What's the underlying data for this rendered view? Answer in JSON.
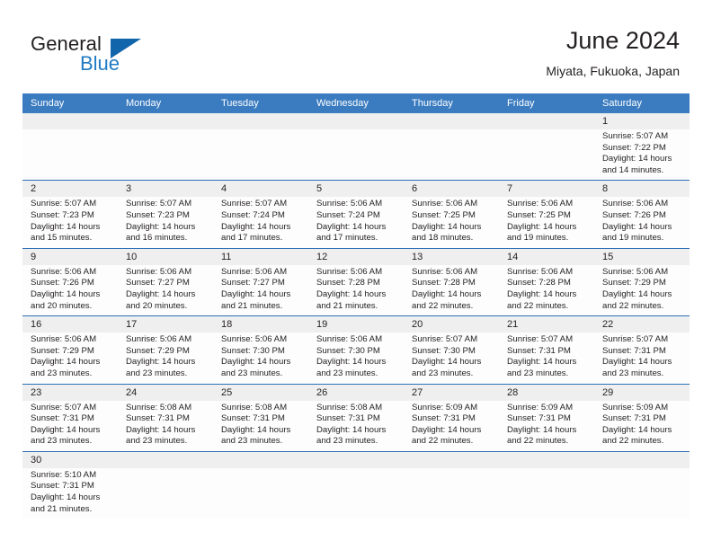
{
  "logo": {
    "word_top": "General",
    "word_bottom": "Blue",
    "triangle_icon": "triangle-icon",
    "color_blue": "#1f7ac4",
    "color_triangle": "#1166ab",
    "color_dark": "#221f1f"
  },
  "header": {
    "title": "June 2024",
    "subtitle": "Miyata, Fukuoka, Japan"
  },
  "theme": {
    "header_blue": "#3b7cc0",
    "row_divider": "#2f6fb5",
    "day_band_gray": "#efefef",
    "cell_bg": "#fdfdfd",
    "text": "#231f20"
  },
  "calendar": {
    "weekdays": [
      "Sunday",
      "Monday",
      "Tuesday",
      "Wednesday",
      "Thursday",
      "Friday",
      "Saturday"
    ],
    "weeks": [
      [
        {
          "day": "",
          "empty": true,
          "lines": []
        },
        {
          "day": "",
          "empty": true,
          "lines": []
        },
        {
          "day": "",
          "empty": true,
          "lines": []
        },
        {
          "day": "",
          "empty": true,
          "lines": []
        },
        {
          "day": "",
          "empty": true,
          "lines": []
        },
        {
          "day": "",
          "empty": true,
          "lines": []
        },
        {
          "day": "1",
          "empty": false,
          "lines": [
            "Sunrise: 5:07 AM",
            "Sunset: 7:22 PM",
            "Daylight: 14 hours",
            "and 14 minutes."
          ]
        }
      ],
      [
        {
          "day": "2",
          "empty": false,
          "lines": [
            "Sunrise: 5:07 AM",
            "Sunset: 7:23 PM",
            "Daylight: 14 hours",
            "and 15 minutes."
          ]
        },
        {
          "day": "3",
          "empty": false,
          "lines": [
            "Sunrise: 5:07 AM",
            "Sunset: 7:23 PM",
            "Daylight: 14 hours",
            "and 16 minutes."
          ]
        },
        {
          "day": "4",
          "empty": false,
          "lines": [
            "Sunrise: 5:07 AM",
            "Sunset: 7:24 PM",
            "Daylight: 14 hours",
            "and 17 minutes."
          ]
        },
        {
          "day": "5",
          "empty": false,
          "lines": [
            "Sunrise: 5:06 AM",
            "Sunset: 7:24 PM",
            "Daylight: 14 hours",
            "and 17 minutes."
          ]
        },
        {
          "day": "6",
          "empty": false,
          "lines": [
            "Sunrise: 5:06 AM",
            "Sunset: 7:25 PM",
            "Daylight: 14 hours",
            "and 18 minutes."
          ]
        },
        {
          "day": "7",
          "empty": false,
          "lines": [
            "Sunrise: 5:06 AM",
            "Sunset: 7:25 PM",
            "Daylight: 14 hours",
            "and 19 minutes."
          ]
        },
        {
          "day": "8",
          "empty": false,
          "lines": [
            "Sunrise: 5:06 AM",
            "Sunset: 7:26 PM",
            "Daylight: 14 hours",
            "and 19 minutes."
          ]
        }
      ],
      [
        {
          "day": "9",
          "empty": false,
          "lines": [
            "Sunrise: 5:06 AM",
            "Sunset: 7:26 PM",
            "Daylight: 14 hours",
            "and 20 minutes."
          ]
        },
        {
          "day": "10",
          "empty": false,
          "lines": [
            "Sunrise: 5:06 AM",
            "Sunset: 7:27 PM",
            "Daylight: 14 hours",
            "and 20 minutes."
          ]
        },
        {
          "day": "11",
          "empty": false,
          "lines": [
            "Sunrise: 5:06 AM",
            "Sunset: 7:27 PM",
            "Daylight: 14 hours",
            "and 21 minutes."
          ]
        },
        {
          "day": "12",
          "empty": false,
          "lines": [
            "Sunrise: 5:06 AM",
            "Sunset: 7:28 PM",
            "Daylight: 14 hours",
            "and 21 minutes."
          ]
        },
        {
          "day": "13",
          "empty": false,
          "lines": [
            "Sunrise: 5:06 AM",
            "Sunset: 7:28 PM",
            "Daylight: 14 hours",
            "and 22 minutes."
          ]
        },
        {
          "day": "14",
          "empty": false,
          "lines": [
            "Sunrise: 5:06 AM",
            "Sunset: 7:28 PM",
            "Daylight: 14 hours",
            "and 22 minutes."
          ]
        },
        {
          "day": "15",
          "empty": false,
          "lines": [
            "Sunrise: 5:06 AM",
            "Sunset: 7:29 PM",
            "Daylight: 14 hours",
            "and 22 minutes."
          ]
        }
      ],
      [
        {
          "day": "16",
          "empty": false,
          "lines": [
            "Sunrise: 5:06 AM",
            "Sunset: 7:29 PM",
            "Daylight: 14 hours",
            "and 23 minutes."
          ]
        },
        {
          "day": "17",
          "empty": false,
          "lines": [
            "Sunrise: 5:06 AM",
            "Sunset: 7:29 PM",
            "Daylight: 14 hours",
            "and 23 minutes."
          ]
        },
        {
          "day": "18",
          "empty": false,
          "lines": [
            "Sunrise: 5:06 AM",
            "Sunset: 7:30 PM",
            "Daylight: 14 hours",
            "and 23 minutes."
          ]
        },
        {
          "day": "19",
          "empty": false,
          "lines": [
            "Sunrise: 5:06 AM",
            "Sunset: 7:30 PM",
            "Daylight: 14 hours",
            "and 23 minutes."
          ]
        },
        {
          "day": "20",
          "empty": false,
          "lines": [
            "Sunrise: 5:07 AM",
            "Sunset: 7:30 PM",
            "Daylight: 14 hours",
            "and 23 minutes."
          ]
        },
        {
          "day": "21",
          "empty": false,
          "lines": [
            "Sunrise: 5:07 AM",
            "Sunset: 7:31 PM",
            "Daylight: 14 hours",
            "and 23 minutes."
          ]
        },
        {
          "day": "22",
          "empty": false,
          "lines": [
            "Sunrise: 5:07 AM",
            "Sunset: 7:31 PM",
            "Daylight: 14 hours",
            "and 23 minutes."
          ]
        }
      ],
      [
        {
          "day": "23",
          "empty": false,
          "lines": [
            "Sunrise: 5:07 AM",
            "Sunset: 7:31 PM",
            "Daylight: 14 hours",
            "and 23 minutes."
          ]
        },
        {
          "day": "24",
          "empty": false,
          "lines": [
            "Sunrise: 5:08 AM",
            "Sunset: 7:31 PM",
            "Daylight: 14 hours",
            "and 23 minutes."
          ]
        },
        {
          "day": "25",
          "empty": false,
          "lines": [
            "Sunrise: 5:08 AM",
            "Sunset: 7:31 PM",
            "Daylight: 14 hours",
            "and 23 minutes."
          ]
        },
        {
          "day": "26",
          "empty": false,
          "lines": [
            "Sunrise: 5:08 AM",
            "Sunset: 7:31 PM",
            "Daylight: 14 hours",
            "and 23 minutes."
          ]
        },
        {
          "day": "27",
          "empty": false,
          "lines": [
            "Sunrise: 5:09 AM",
            "Sunset: 7:31 PM",
            "Daylight: 14 hours",
            "and 22 minutes."
          ]
        },
        {
          "day": "28",
          "empty": false,
          "lines": [
            "Sunrise: 5:09 AM",
            "Sunset: 7:31 PM",
            "Daylight: 14 hours",
            "and 22 minutes."
          ]
        },
        {
          "day": "29",
          "empty": false,
          "lines": [
            "Sunrise: 5:09 AM",
            "Sunset: 7:31 PM",
            "Daylight: 14 hours",
            "and 22 minutes."
          ]
        }
      ],
      [
        {
          "day": "30",
          "empty": false,
          "lines": [
            "Sunrise: 5:10 AM",
            "Sunset: 7:31 PM",
            "Daylight: 14 hours",
            "and 21 minutes."
          ]
        },
        {
          "day": "",
          "empty": true,
          "lines": []
        },
        {
          "day": "",
          "empty": true,
          "lines": []
        },
        {
          "day": "",
          "empty": true,
          "lines": []
        },
        {
          "day": "",
          "empty": true,
          "lines": []
        },
        {
          "day": "",
          "empty": true,
          "lines": []
        },
        {
          "day": "",
          "empty": true,
          "lines": []
        }
      ]
    ]
  }
}
